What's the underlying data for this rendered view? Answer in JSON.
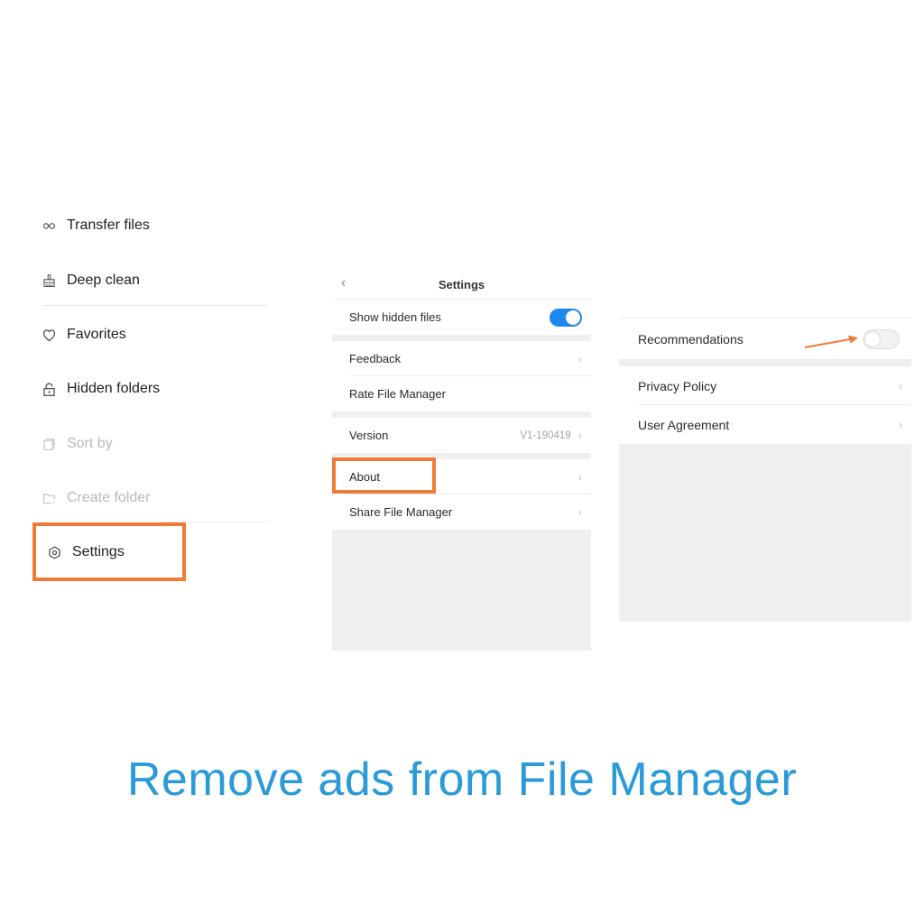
{
  "left_menu": {
    "items": [
      {
        "label": "Transfer files",
        "icon": "transfer-icon",
        "enabled": true
      },
      {
        "label": "Deep clean",
        "icon": "broom-icon",
        "enabled": true
      },
      {
        "label": "Favorites",
        "icon": "heart-icon",
        "enabled": true
      },
      {
        "label": "Hidden folders",
        "icon": "lock-icon",
        "enabled": true
      },
      {
        "label": "Sort by",
        "icon": "sort-icon",
        "enabled": false
      },
      {
        "label": "Create folder",
        "icon": "folder-plus-icon",
        "enabled": false
      },
      {
        "label": "Settings",
        "icon": "gear-icon",
        "enabled": true,
        "highlighted": true
      }
    ]
  },
  "settings_panel": {
    "title": "Settings",
    "back_icon": "chevron-left-icon",
    "show_hidden_files": {
      "label": "Show hidden files",
      "toggle_on": true
    },
    "feedback": {
      "label": "Feedback"
    },
    "rate": {
      "label": "Rate File Manager"
    },
    "version": {
      "label": "Version",
      "value": "V1-190419"
    },
    "about": {
      "label": "About",
      "highlighted": true
    },
    "share": {
      "label": "Share File Manager"
    },
    "chevron": "›"
  },
  "about_panel": {
    "recommendations": {
      "label": "Recommendations",
      "toggle_on": false
    },
    "privacy": {
      "label": "Privacy Policy"
    },
    "agreement": {
      "label": "User Agreement"
    },
    "chevron": "›"
  },
  "banner": {
    "text": "Remove ads from File Manager"
  },
  "colors": {
    "highlight": "#f07b36",
    "toggle_on": "#1e88f0",
    "banner": "#2a9ad8",
    "disabled_text": "#b9b9b9"
  }
}
